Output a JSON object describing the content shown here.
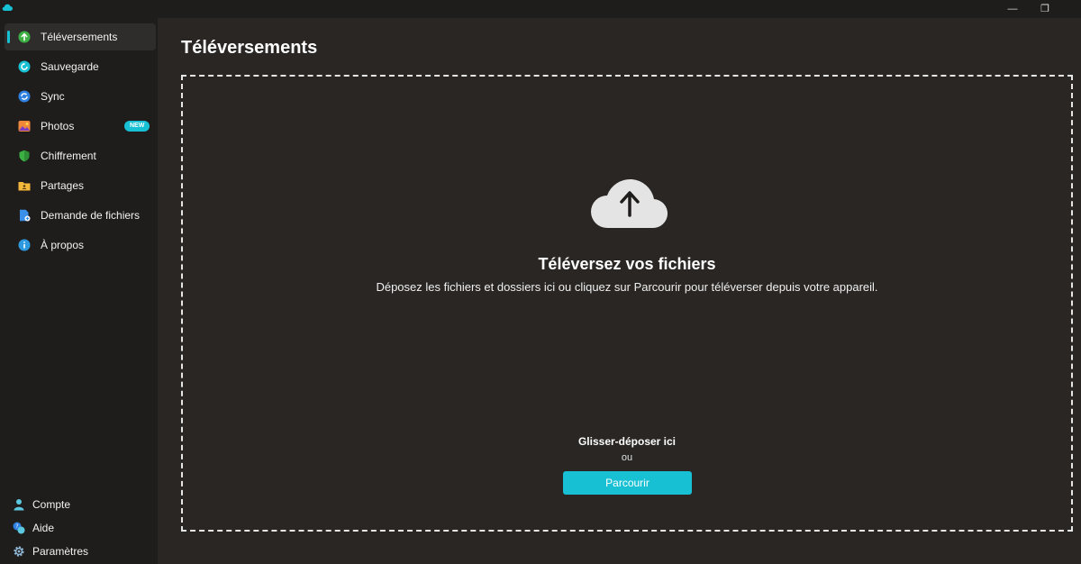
{
  "window": {
    "minimize_glyph": "—",
    "maximize_glyph": "❐"
  },
  "sidebar": {
    "items": [
      {
        "label": "Téléversements",
        "icon": "upload-icon",
        "active": true
      },
      {
        "label": "Sauvegarde",
        "icon": "backup-icon"
      },
      {
        "label": "Sync",
        "icon": "sync-icon"
      },
      {
        "label": "Photos",
        "icon": "photos-icon",
        "badge": "NEW"
      },
      {
        "label": "Chiffrement",
        "icon": "shield-icon"
      },
      {
        "label": "Partages",
        "icon": "shared-folder-icon"
      },
      {
        "label": "Demande de fichiers",
        "icon": "file-request-icon"
      },
      {
        "label": "À propos",
        "icon": "info-icon"
      }
    ],
    "bottom": [
      {
        "label": "Compte",
        "icon": "account-icon"
      },
      {
        "label": "Aide",
        "icon": "help-icon"
      },
      {
        "label": "Paramètres",
        "icon": "gear-icon"
      }
    ]
  },
  "main": {
    "title": "Téléversements",
    "dropzone": {
      "heading": "Téléversez vos fichiers",
      "description": "Déposez les fichiers et dossiers ici ou cliquez sur Parcourir pour téléverser depuis votre appareil.",
      "drag_label": "Glisser-déposer ici",
      "or_label": "ou",
      "browse_label": "Parcourir"
    }
  },
  "colors": {
    "accent": "#18c0d4",
    "sidebar_bg": "#1f1d1c",
    "main_bg": "#292624",
    "active_item_bg": "#2f2d2b"
  }
}
